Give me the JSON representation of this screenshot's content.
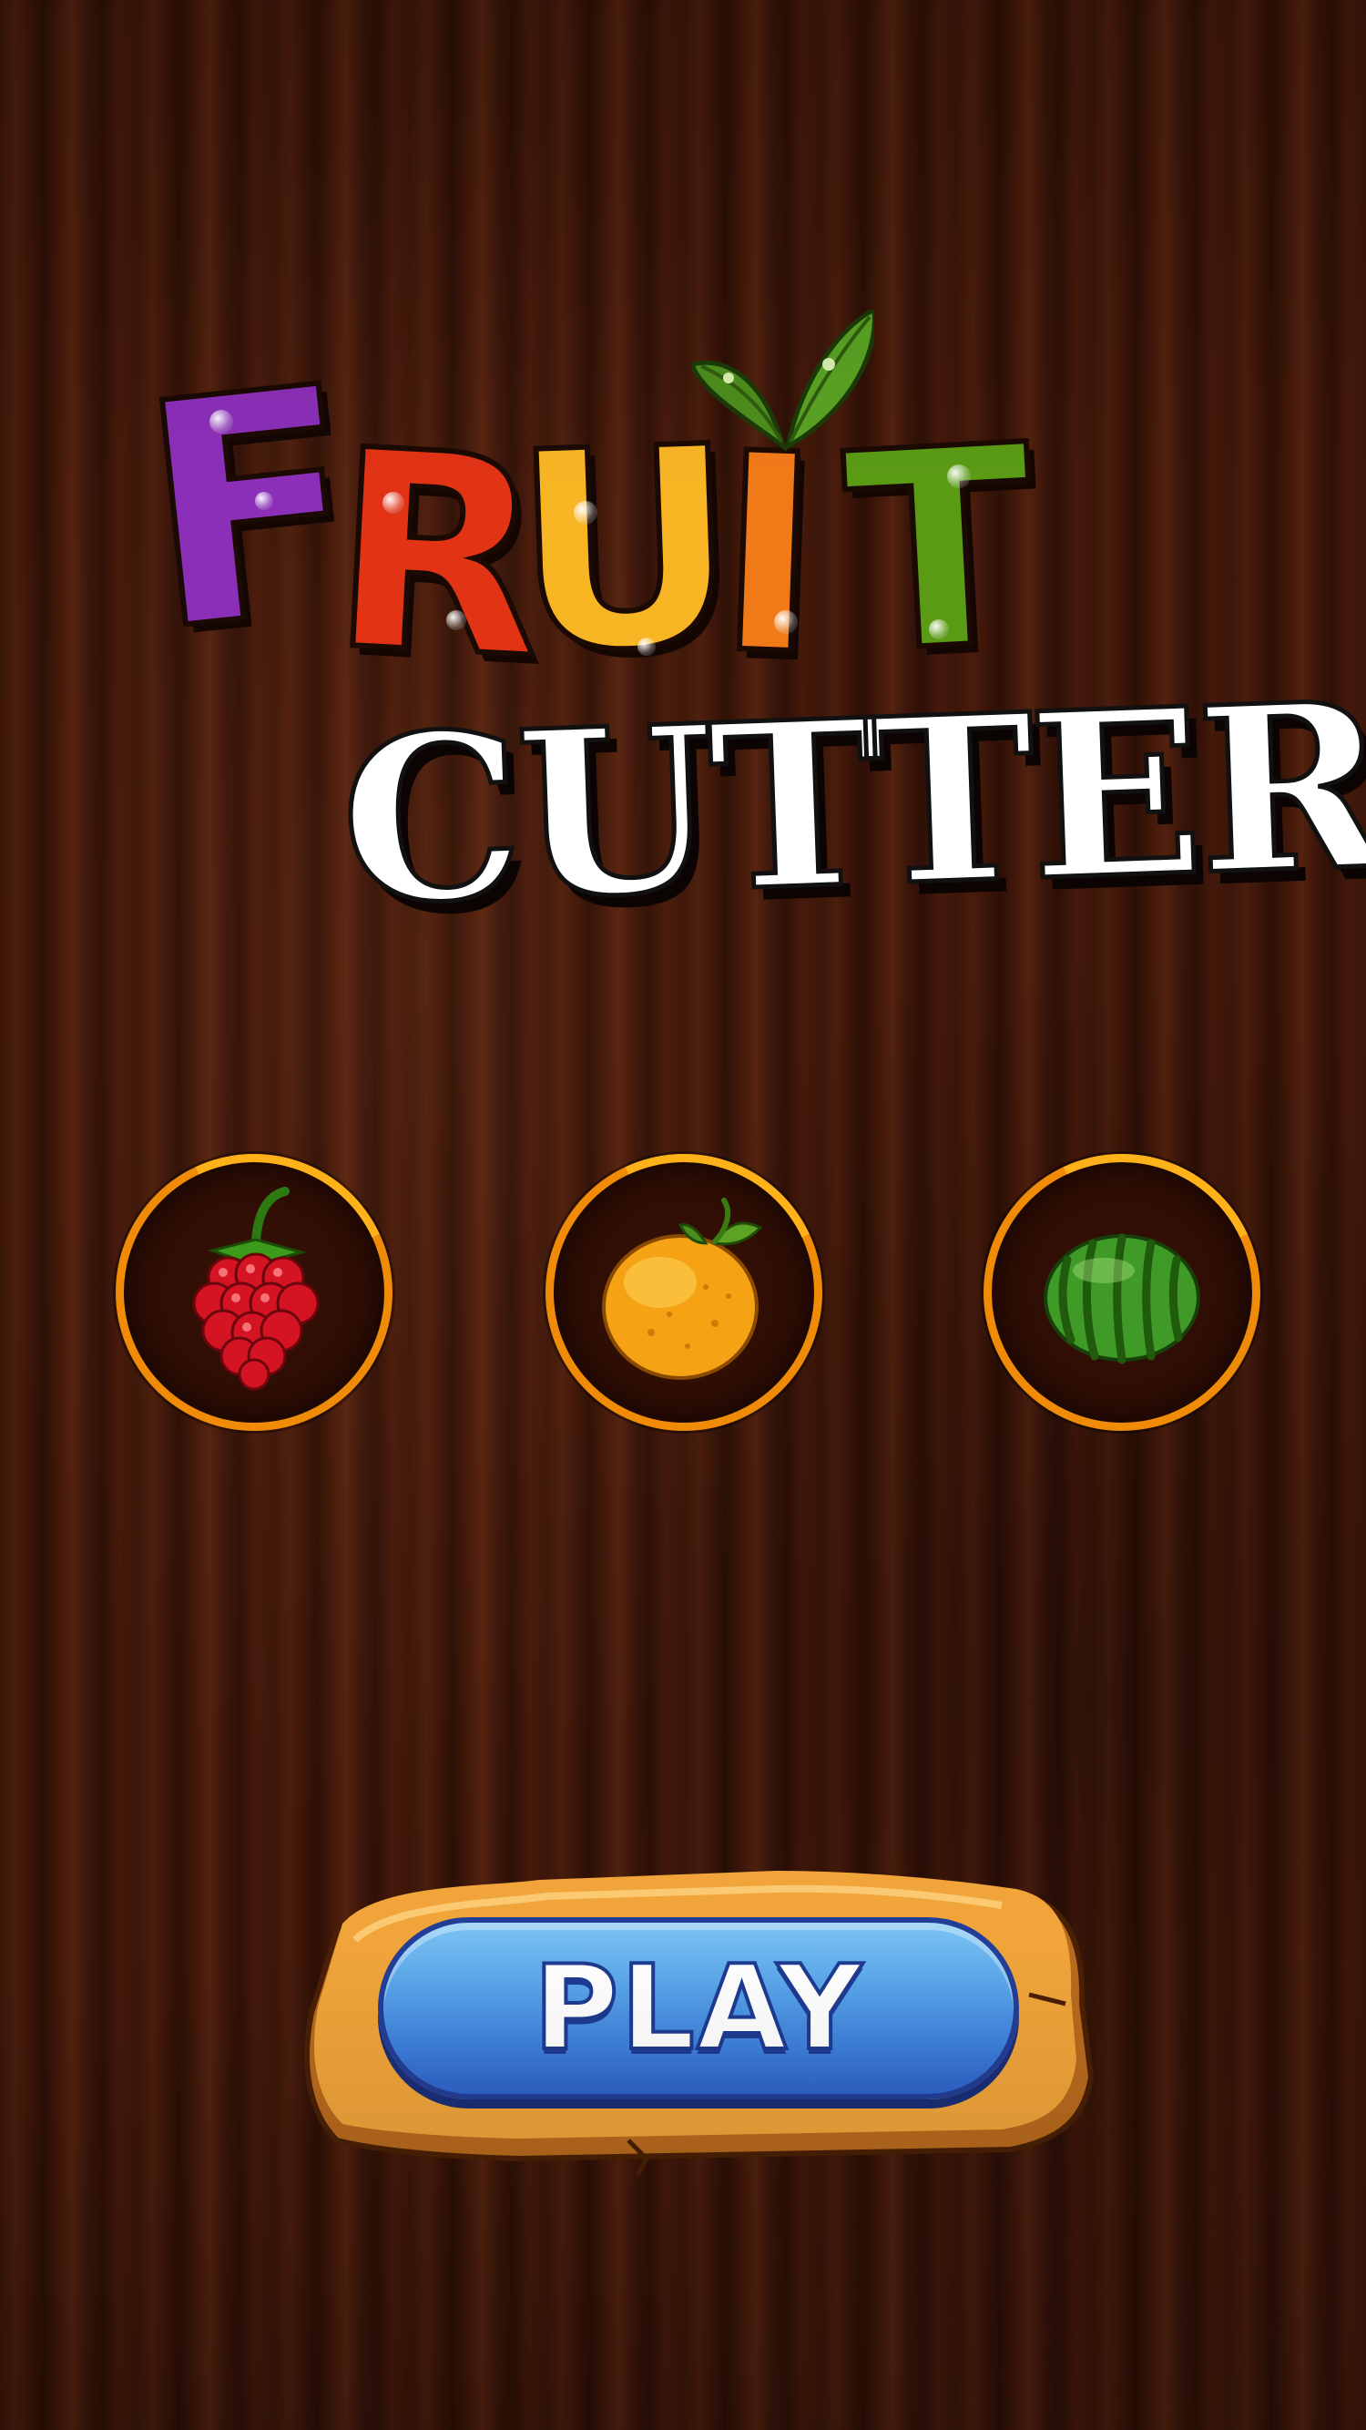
{
  "title": {
    "line1_letters": [
      "F",
      "R",
      "U",
      "I",
      "T"
    ],
    "line2": "CUTTER"
  },
  "fruit_options": [
    {
      "name": "raspberry",
      "icon": "raspberry-icon"
    },
    {
      "name": "orange",
      "icon": "orange-icon"
    },
    {
      "name": "watermelon",
      "icon": "watermelon-icon"
    }
  ],
  "play_button": {
    "label": "PLAY"
  },
  "colors": {
    "background": "#3a1609",
    "ring": "#ef8b06",
    "play_button": "#4a90e2",
    "stone": "#f0a43a",
    "letter_f": "#8b2fb8",
    "letter_r": "#e23315",
    "letter_u": "#f7b524",
    "letter_i": "#f17a18",
    "letter_t": "#5a9b14"
  }
}
